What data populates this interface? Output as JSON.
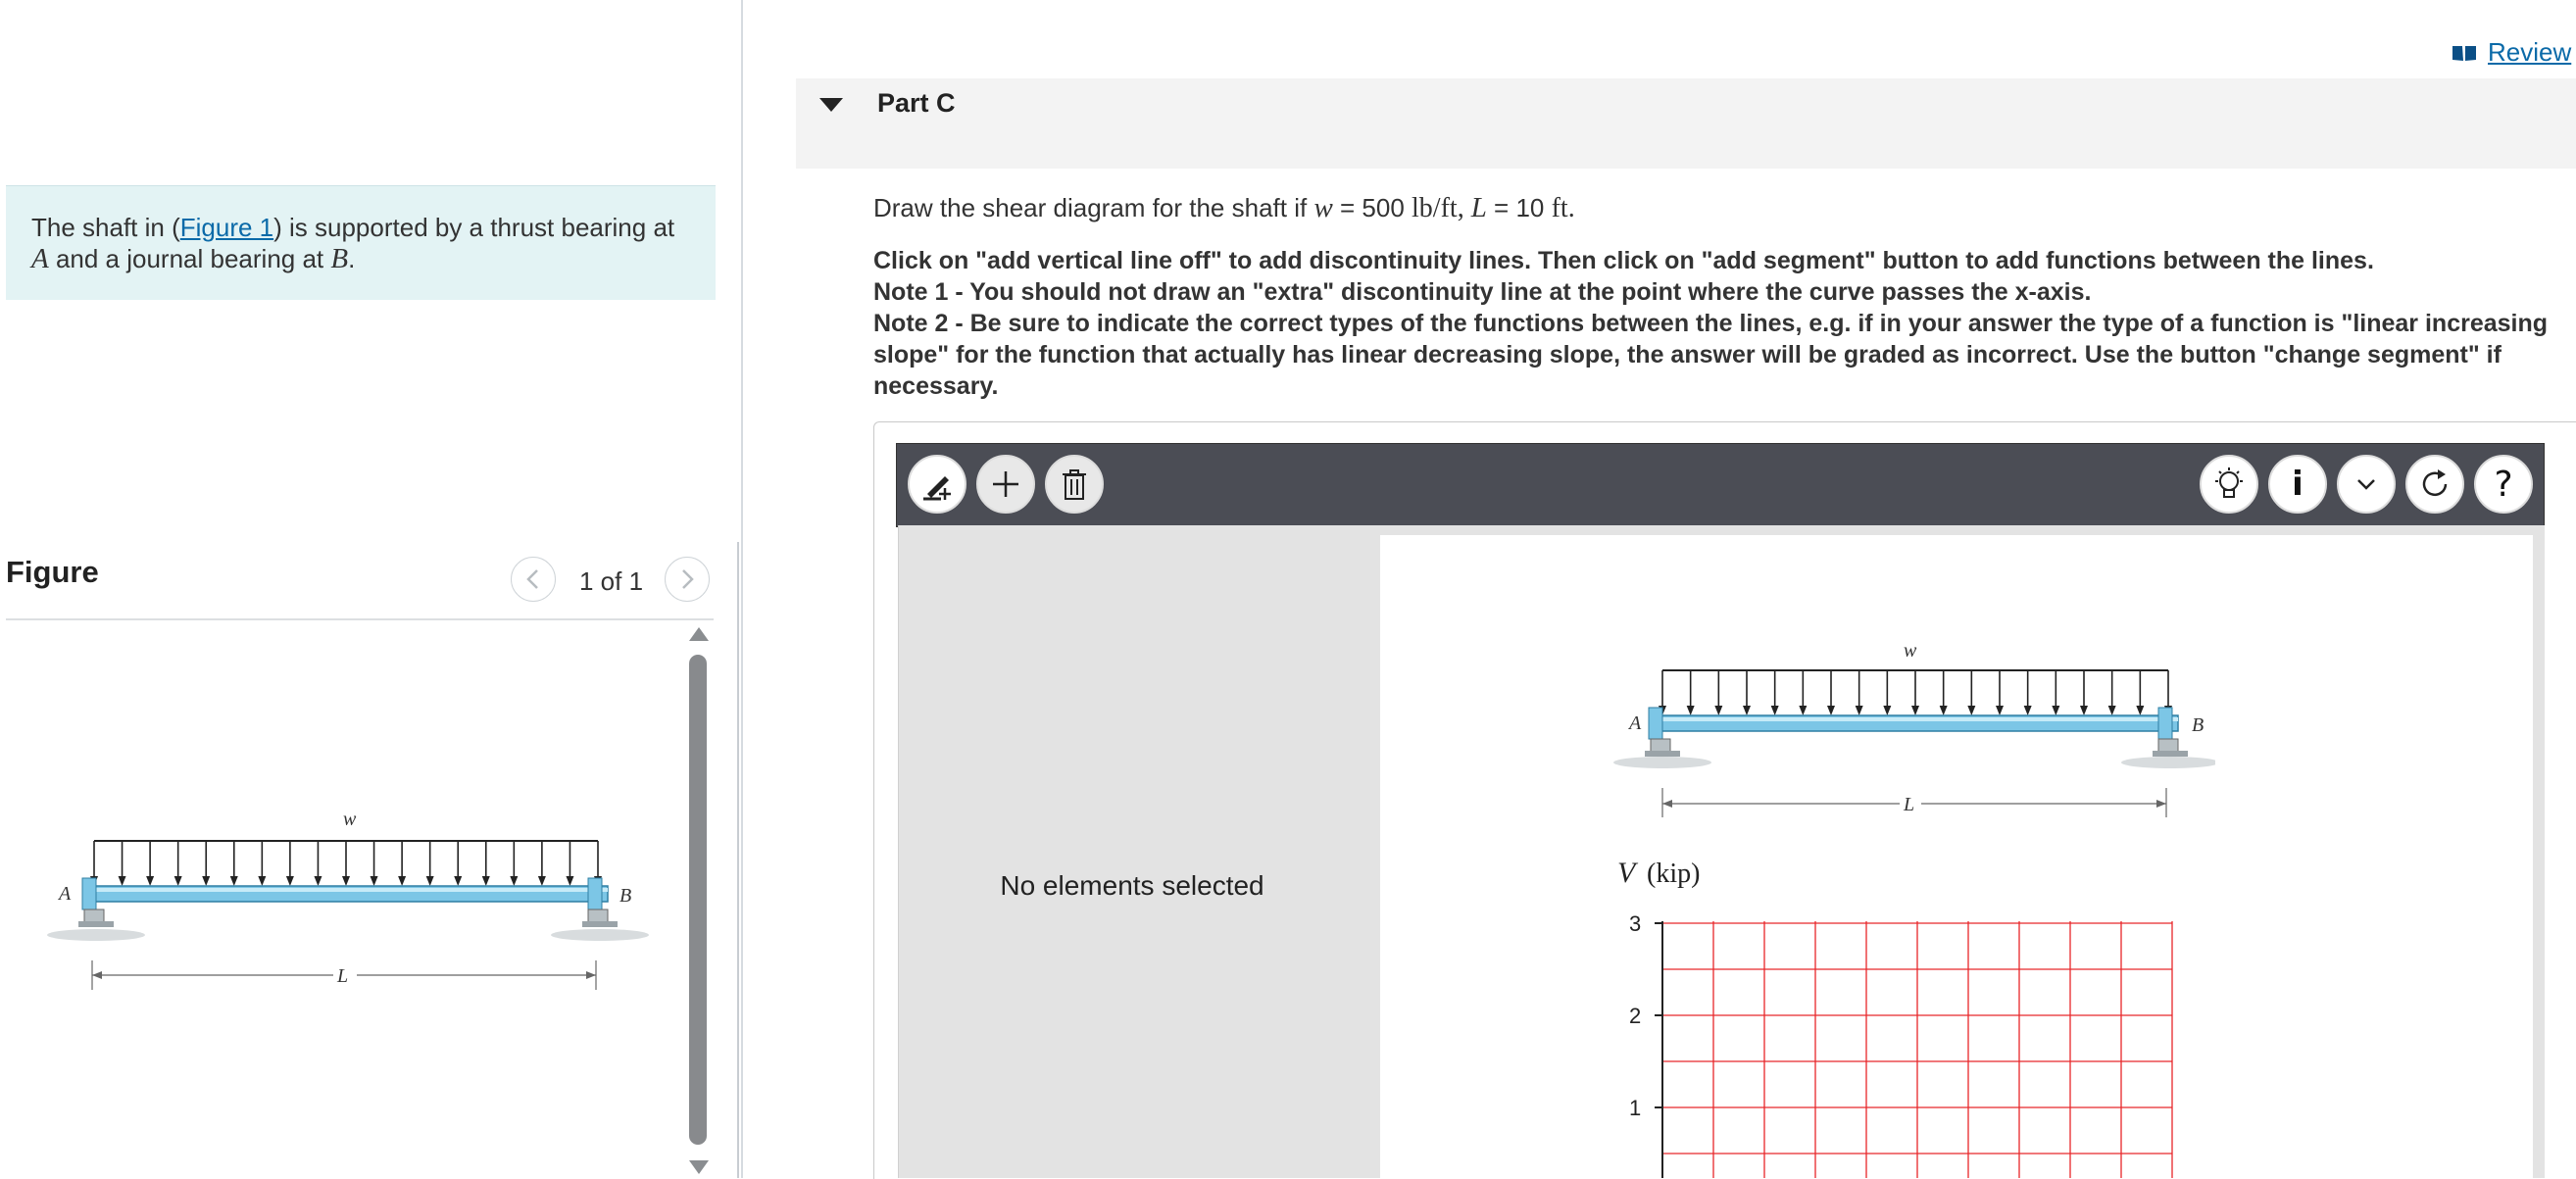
{
  "left_panel": {
    "intro": {
      "text_before": "The shaft in (",
      "link": "Figure 1",
      "text_mid": ") is supported by a thrust bearing at",
      "var_a": "A",
      "text_mid2": " and a journal bearing at ",
      "var_b": "B",
      "text_end": "."
    },
    "figure_title": "Figure",
    "figure_count": "1 of 1",
    "prev_icon": "chevron-left-icon",
    "next_icon": "chevron-right-icon"
  },
  "figure": {
    "label_a": "A",
    "label_b": "B",
    "label_w": "w",
    "label_l": "L"
  },
  "review_link": "Review",
  "part": {
    "title": "Part C",
    "question_prefix": "Draw the shear diagram for the shaft if ",
    "question_w": "w",
    "question_eq1": " = 500 ",
    "question_unit1": "lb/ft",
    "question_comma": ", ",
    "question_l": "L",
    "question_eq2": " = 10 ",
    "question_unit2": "ft",
    "question_end": ".",
    "instructions": [
      "Click on \"add vertical line off\" to add discontinuity lines. Then click on \"add segment\" button to add functions between the lines.",
      "Note 1 - You should not draw an \"extra\" discontinuity line at the point where the curve passes the x-axis.",
      "Note 2 - Be sure to indicate the correct types of the functions between the lines, e.g. if in your answer the type of a function is \"linear increasing slope\" for the function that actually has linear decreasing slope, the answer will be graded as incorrect. Use the button \"change segment\" if necessary."
    ]
  },
  "toolbar": {
    "left_icons": [
      "draw-line-icon",
      "plus-icon",
      "trash-icon"
    ],
    "right_icons": [
      "lightbulb-icon",
      "info-icon",
      "chevron-down-icon",
      "reset-icon",
      "help-icon"
    ],
    "info_glyph": "i",
    "help_glyph": "?"
  },
  "workarea": {
    "no_selection": "No elements selected"
  },
  "graph": {
    "ylabel_var": "V",
    "ylabel_unit": "(kip)",
    "yticks": [
      "3",
      "2",
      "1"
    ],
    "grid_color": "#e8272a"
  }
}
